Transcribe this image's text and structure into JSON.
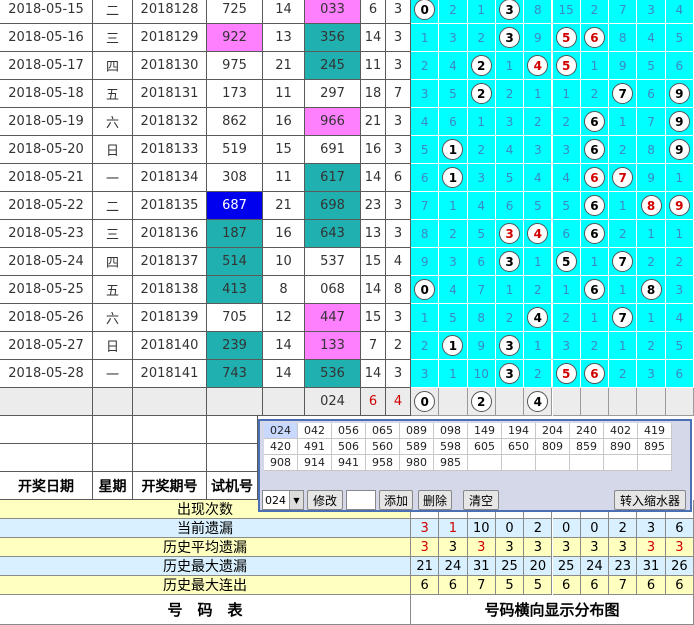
{
  "rows": [
    {
      "date": "2018-05-15",
      "weekday": "二",
      "issue": "2018128",
      "trial": "725",
      "trial_bg": "",
      "sum": "14",
      "draw": "033",
      "draw_bg": "#ff80ff",
      "span": "6",
      "v": "3",
      "dist": [
        {
          "t": "0",
          "c": "ring"
        },
        {
          "t": "2"
        },
        {
          "t": "1"
        },
        {
          "t": "3",
          "c": "ring"
        },
        {
          "t": "8"
        },
        {
          "t": "15"
        },
        {
          "t": "2"
        },
        {
          "t": "7"
        },
        {
          "t": "3"
        },
        {
          "t": "4"
        }
      ]
    },
    {
      "date": "2018-05-16",
      "weekday": "三",
      "issue": "2018129",
      "trial": "922",
      "trial_bg": "#ff80ff",
      "sum": "13",
      "draw": "356",
      "draw_bg": "#20b0b0",
      "span": "14",
      "v": "3",
      "dist": [
        {
          "t": "1"
        },
        {
          "t": "3"
        },
        {
          "t": "2"
        },
        {
          "t": "3",
          "c": "ring"
        },
        {
          "t": "9"
        },
        {
          "t": "5",
          "c": "ring red"
        },
        {
          "t": "6",
          "c": "ring red"
        },
        {
          "t": "8"
        },
        {
          "t": "4"
        },
        {
          "t": "5"
        }
      ]
    },
    {
      "date": "2018-05-17",
      "weekday": "四",
      "issue": "2018130",
      "trial": "975",
      "trial_bg": "",
      "sum": "21",
      "draw": "245",
      "draw_bg": "#20b0b0",
      "span": "11",
      "v": "3",
      "dist": [
        {
          "t": "2"
        },
        {
          "t": "4"
        },
        {
          "t": "2",
          "c": "ring"
        },
        {
          "t": "1"
        },
        {
          "t": "4",
          "c": "ring red"
        },
        {
          "t": "5",
          "c": "ring red"
        },
        {
          "t": "1"
        },
        {
          "t": "9"
        },
        {
          "t": "5"
        },
        {
          "t": "6"
        }
      ]
    },
    {
      "date": "2018-05-18",
      "weekday": "五",
      "issue": "2018131",
      "trial": "173",
      "trial_bg": "",
      "sum": "11",
      "draw": "297",
      "draw_bg": "",
      "span": "18",
      "v": "7",
      "dist": [
        {
          "t": "3"
        },
        {
          "t": "5"
        },
        {
          "t": "2",
          "c": "ring"
        },
        {
          "t": "2"
        },
        {
          "t": "1"
        },
        {
          "t": "1"
        },
        {
          "t": "2"
        },
        {
          "t": "7",
          "c": "ring"
        },
        {
          "t": "6"
        },
        {
          "t": "9",
          "c": "ring"
        }
      ]
    },
    {
      "date": "2018-05-19",
      "weekday": "六",
      "issue": "2018132",
      "trial": "862",
      "trial_bg": "",
      "sum": "16",
      "draw": "966",
      "draw_bg": "#ff80ff",
      "span": "21",
      "v": "3",
      "dist": [
        {
          "t": "4"
        },
        {
          "t": "6"
        },
        {
          "t": "1"
        },
        {
          "t": "3"
        },
        {
          "t": "2"
        },
        {
          "t": "2"
        },
        {
          "t": "6",
          "c": "ring"
        },
        {
          "t": "1"
        },
        {
          "t": "7"
        },
        {
          "t": "9",
          "c": "ring"
        }
      ]
    },
    {
      "date": "2018-05-20",
      "weekday": "日",
      "issue": "2018133",
      "trial": "519",
      "trial_bg": "",
      "sum": "15",
      "draw": "691",
      "draw_bg": "",
      "span": "16",
      "v": "3",
      "dist": [
        {
          "t": "5"
        },
        {
          "t": "1",
          "c": "ring"
        },
        {
          "t": "2"
        },
        {
          "t": "4"
        },
        {
          "t": "3"
        },
        {
          "t": "3"
        },
        {
          "t": "6",
          "c": "ring"
        },
        {
          "t": "2"
        },
        {
          "t": "8"
        },
        {
          "t": "9",
          "c": "ring"
        }
      ]
    },
    {
      "date": "2018-05-21",
      "weekday": "一",
      "issue": "2018134",
      "trial": "308",
      "trial_bg": "",
      "sum": "11",
      "draw": "617",
      "draw_bg": "#20b0b0",
      "span": "14",
      "v": "6",
      "dist": [
        {
          "t": "6"
        },
        {
          "t": "1",
          "c": "ring"
        },
        {
          "t": "3"
        },
        {
          "t": "5"
        },
        {
          "t": "4"
        },
        {
          "t": "4"
        },
        {
          "t": "6",
          "c": "ring red"
        },
        {
          "t": "7",
          "c": "ring red"
        },
        {
          "t": "9"
        },
        {
          "t": "1"
        }
      ]
    },
    {
      "date": "2018-05-22",
      "weekday": "二",
      "issue": "2018135",
      "trial": "687",
      "trial_bg": "#0000ee",
      "sum": "21",
      "draw": "698",
      "draw_bg": "#20b0b0",
      "span": "23",
      "v": "3",
      "dist": [
        {
          "t": "7"
        },
        {
          "t": "1"
        },
        {
          "t": "4"
        },
        {
          "t": "6"
        },
        {
          "t": "5"
        },
        {
          "t": "5"
        },
        {
          "t": "6",
          "c": "ring"
        },
        {
          "t": "1"
        },
        {
          "t": "8",
          "c": "ring red"
        },
        {
          "t": "9",
          "c": "ring red"
        }
      ]
    },
    {
      "date": "2018-05-23",
      "weekday": "三",
      "issue": "2018136",
      "trial": "187",
      "trial_bg": "#20b0b0",
      "sum": "16",
      "draw": "643",
      "draw_bg": "#20b0b0",
      "span": "13",
      "v": "3",
      "dist": [
        {
          "t": "8"
        },
        {
          "t": "2"
        },
        {
          "t": "5"
        },
        {
          "t": "3",
          "c": "ring red"
        },
        {
          "t": "4",
          "c": "ring red"
        },
        {
          "t": "6"
        },
        {
          "t": "6",
          "c": "ring"
        },
        {
          "t": "2"
        },
        {
          "t": "1"
        },
        {
          "t": "1"
        }
      ]
    },
    {
      "date": "2018-05-24",
      "weekday": "四",
      "issue": "2018137",
      "trial": "514",
      "trial_bg": "#20b0b0",
      "sum": "10",
      "draw": "537",
      "draw_bg": "",
      "span": "15",
      "v": "4",
      "dist": [
        {
          "t": "9"
        },
        {
          "t": "3"
        },
        {
          "t": "6"
        },
        {
          "t": "3",
          "c": "ring"
        },
        {
          "t": "1"
        },
        {
          "t": "5",
          "c": "ring"
        },
        {
          "t": "1"
        },
        {
          "t": "7",
          "c": "ring"
        },
        {
          "t": "2"
        },
        {
          "t": "2"
        }
      ]
    },
    {
      "date": "2018-05-25",
      "weekday": "五",
      "issue": "2018138",
      "trial": "413",
      "trial_bg": "#20b0b0",
      "sum": "8",
      "draw": "068",
      "draw_bg": "",
      "span": "14",
      "v": "8",
      "dist": [
        {
          "t": "0",
          "c": "ring"
        },
        {
          "t": "4"
        },
        {
          "t": "7"
        },
        {
          "t": "1"
        },
        {
          "t": "2"
        },
        {
          "t": "1"
        },
        {
          "t": "6",
          "c": "ring"
        },
        {
          "t": "1"
        },
        {
          "t": "8",
          "c": "ring"
        },
        {
          "t": "3"
        }
      ]
    },
    {
      "date": "2018-05-26",
      "weekday": "六",
      "issue": "2018139",
      "trial": "705",
      "trial_bg": "",
      "sum": "12",
      "draw": "447",
      "draw_bg": "#ff80ff",
      "span": "15",
      "v": "3",
      "dist": [
        {
          "t": "1"
        },
        {
          "t": "5"
        },
        {
          "t": "8"
        },
        {
          "t": "2"
        },
        {
          "t": "4",
          "c": "ring"
        },
        {
          "t": "2"
        },
        {
          "t": "1"
        },
        {
          "t": "7",
          "c": "ring"
        },
        {
          "t": "1"
        },
        {
          "t": "4"
        }
      ]
    },
    {
      "date": "2018-05-27",
      "weekday": "日",
      "issue": "2018140",
      "trial": "239",
      "trial_bg": "#20b0b0",
      "sum": "14",
      "draw": "133",
      "draw_bg": "#ff80ff",
      "span": "7",
      "v": "2",
      "dist": [
        {
          "t": "2"
        },
        {
          "t": "1",
          "c": "ring"
        },
        {
          "t": "9"
        },
        {
          "t": "3",
          "c": "ring"
        },
        {
          "t": "1"
        },
        {
          "t": "3"
        },
        {
          "t": "2"
        },
        {
          "t": "1"
        },
        {
          "t": "2"
        },
        {
          "t": "5"
        }
      ]
    },
    {
      "date": "2018-05-28",
      "weekday": "一",
      "issue": "2018141",
      "trial": "743",
      "trial_bg": "#20b0b0",
      "sum": "14",
      "draw": "536",
      "draw_bg": "#20b0b0",
      "span": "14",
      "v": "3",
      "dist": [
        {
          "t": "3"
        },
        {
          "t": "1"
        },
        {
          "t": "10"
        },
        {
          "t": "3",
          "c": "ring"
        },
        {
          "t": "2"
        },
        {
          "t": "5",
          "c": "ring red"
        },
        {
          "t": "6",
          "c": "ring red"
        },
        {
          "t": "2"
        },
        {
          "t": "3"
        },
        {
          "t": "6"
        }
      ]
    }
  ],
  "pending_row": {
    "draw": "024",
    "span": "6",
    "v": "4",
    "dist": [
      {
        "t": "0",
        "c": "ring"
      },
      {
        "t": ""
      },
      {
        "t": "2",
        "c": "ring"
      },
      {
        "t": ""
      },
      {
        "t": "4",
        "c": "ring"
      },
      {
        "t": ""
      },
      {
        "t": ""
      },
      {
        "t": ""
      },
      {
        "t": ""
      },
      {
        "t": ""
      }
    ]
  },
  "headers": {
    "date": "开奖日期",
    "weekday": "星期",
    "issue": "开奖期号",
    "trial": "试机号"
  },
  "stats": {
    "labels": [
      "出现次数",
      "当前遗漏",
      "历史平均遗漏",
      "历史最大遗漏",
      "历史最大连出"
    ],
    "current_omit": [
      "3",
      "1",
      "10",
      "0",
      "2",
      "0",
      "0",
      "2",
      "3",
      "6"
    ],
    "avg_omit": [
      "3",
      "3",
      "3",
      "3",
      "3",
      "3",
      "3",
      "3",
      "3",
      "3"
    ],
    "max_omit": [
      "21",
      "24",
      "31",
      "25",
      "20",
      "25",
      "24",
      "23",
      "31",
      "26"
    ],
    "max_streak": [
      "6",
      "6",
      "7",
      "5",
      "5",
      "6",
      "6",
      "7",
      "6",
      "6"
    ]
  },
  "footer": {
    "left": "号　码　表",
    "right": "号码横向显示分布图"
  },
  "popup": {
    "grid": [
      "024",
      "042",
      "056",
      "065",
      "089",
      "098",
      "149",
      "194",
      "204",
      "240",
      "402",
      "419",
      "420",
      "491",
      "506",
      "560",
      "589",
      "598",
      "605",
      "650",
      "809",
      "859",
      "890",
      "895",
      "908",
      "914",
      "941",
      "958",
      "980",
      "985"
    ],
    "select_value": "024",
    "buttons": {
      "modify": "修改",
      "add": "添加",
      "delete": "删除",
      "clear": "清空",
      "zoom": "转入缩水器"
    }
  },
  "colors": {
    "dist_bg": "#00ffff",
    "magenta": "#ff80ff",
    "teal": "#20b0b0",
    "blue": "#0000ee",
    "stat_yellow": "#ffffc0",
    "stat_blue": "#d8f0ff"
  }
}
